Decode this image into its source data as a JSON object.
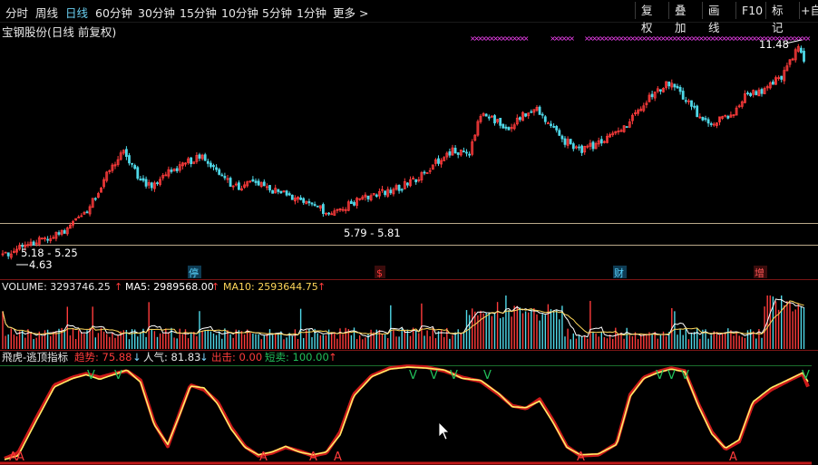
{
  "toolbar": {
    "periods": [
      "分时",
      "周线",
      "日线",
      "60分钟",
      "30分钟",
      "15分钟",
      "10分钟",
      "5分钟",
      "1分钟",
      "更多 >"
    ],
    "active_period": "日线",
    "right_buttons": [
      "复权",
      "叠加",
      "画线",
      "F10",
      "标记",
      "+自"
    ]
  },
  "stock_title": "宝钢股份(日线 前复权)",
  "colors": {
    "up": "#ff3b3b",
    "down": "#4fd8e8",
    "bg": "#000000",
    "ma5": "#ffffff",
    "ma10": "#ffd75a",
    "indicator_red": "#cc1a1a",
    "indicator_yellow": "#ffee66",
    "signal_green": "#22c05a",
    "marker_magenta": "#ff44ff"
  },
  "main_panel": {
    "annotations": {
      "high": "11.48",
      "low": "4.63",
      "zone1": "5.18 - 5.25",
      "zone2": "5.79 - 5.81"
    },
    "event_markers": [
      "停",
      "$",
      "财",
      "增"
    ]
  },
  "volume_panel": {
    "label_volume": "VOLUME: 3293746.25",
    "label_ma5": "MA5: 2989568.00",
    "label_ma10": "MA10: 2593644.75",
    "arrow": "↑"
  },
  "indicator_panel": {
    "name": "飛虎-逃顶指标",
    "trend_label": "趋势: 75.88",
    "trend_arrow": "↓",
    "popularity_label": "人气: 81.83",
    "popularity_arrow": "↓",
    "exit_label": "出击: 0.00",
    "short_label": "短卖: 100.00",
    "short_arrow": "↑",
    "signal_top": "V",
    "signal_bottom": "A"
  },
  "chart_data": [
    {
      "type": "candlestick",
      "title": "宝钢股份(日线 前复权)",
      "ylim": [
        4.3,
        12.1
      ],
      "price_path": [
        [
          0,
          4.9
        ],
        [
          10,
          4.75
        ],
        [
          25,
          5.2
        ],
        [
          45,
          5.3
        ],
        [
          70,
          5.6
        ],
        [
          95,
          6.2
        ],
        [
          115,
          7.3
        ],
        [
          135,
          8.2
        ],
        [
          150,
          7.4
        ],
        [
          165,
          7.0
        ],
        [
          185,
          7.5
        ],
        [
          200,
          7.7
        ],
        [
          220,
          8.0
        ],
        [
          240,
          7.4
        ],
        [
          260,
          7.0
        ],
        [
          280,
          7.2
        ],
        [
          300,
          6.9
        ],
        [
          320,
          6.7
        ],
        [
          340,
          6.5
        ],
        [
          360,
          6.2
        ],
        [
          375,
          6.3
        ],
        [
          395,
          6.6
        ],
        [
          415,
          6.8
        ],
        [
          440,
          7.0
        ],
        [
          460,
          7.3
        ],
        [
          480,
          7.8
        ],
        [
          500,
          8.2
        ],
        [
          515,
          8.0
        ],
        [
          530,
          9.4
        ],
        [
          545,
          9.1
        ],
        [
          560,
          8.9
        ],
        [
          575,
          9.3
        ],
        [
          590,
          9.5
        ],
        [
          605,
          9.0
        ],
        [
          620,
          8.5
        ],
        [
          640,
          8.2
        ],
        [
          660,
          8.4
        ],
        [
          680,
          8.7
        ],
        [
          700,
          9.3
        ],
        [
          720,
          10.0
        ],
        [
          740,
          10.4
        ],
        [
          750,
          10.0
        ],
        [
          760,
          9.6
        ],
        [
          775,
          9.1
        ],
        [
          790,
          9.1
        ],
        [
          805,
          9.3
        ],
        [
          820,
          9.9
        ],
        [
          840,
          10.1
        ],
        [
          860,
          10.5
        ],
        [
          870,
          11.0
        ],
        [
          880,
          11.48
        ],
        [
          888,
          10.7
        ]
      ]
    },
    {
      "type": "bar",
      "title": "VOLUME",
      "series": [
        {
          "name": "VOLUME",
          "last": 3293746.25
        },
        {
          "name": "MA5",
          "last": 2989568.0
        },
        {
          "name": "MA10",
          "last": 2593644.75
        }
      ]
    },
    {
      "type": "line",
      "title": "飛虎-逃顶指标",
      "ylim": [
        0,
        100
      ],
      "series": [
        {
          "name": "趋势",
          "last": 75.88,
          "values": [
            [
              5,
              2
            ],
            [
              20,
              8
            ],
            [
              40,
              45
            ],
            [
              60,
              80
            ],
            [
              80,
              88
            ],
            [
              95,
              92
            ],
            [
              110,
              88
            ],
            [
              125,
              92
            ],
            [
              140,
              95
            ],
            [
              155,
              85
            ],
            [
              170,
              40
            ],
            [
              185,
              15
            ],
            [
              200,
              55
            ],
            [
              210,
              80
            ],
            [
              225,
              75
            ],
            [
              240,
              62
            ],
            [
              255,
              35
            ],
            [
              270,
              15
            ],
            [
              285,
              5
            ],
            [
              300,
              8
            ],
            [
              315,
              14
            ],
            [
              330,
              10
            ],
            [
              345,
              5
            ],
            [
              360,
              8
            ],
            [
              375,
              30
            ],
            [
              390,
              70
            ],
            [
              410,
              90
            ],
            [
              430,
              98
            ],
            [
              450,
              100
            ],
            [
              470,
              99
            ],
            [
              490,
              95
            ],
            [
              510,
              88
            ],
            [
              530,
              84
            ],
            [
              550,
              70
            ],
            [
              565,
              58
            ],
            [
              580,
              55
            ],
            [
              595,
              65
            ],
            [
              610,
              42
            ],
            [
              625,
              15
            ],
            [
              640,
              5
            ],
            [
              660,
              6
            ],
            [
              680,
              18
            ],
            [
              695,
              70
            ],
            [
              710,
              88
            ],
            [
              725,
              94
            ],
            [
              740,
              98
            ],
            [
              755,
              95
            ],
            [
              770,
              60
            ],
            [
              785,
              30
            ],
            [
              800,
              12
            ],
            [
              815,
              20
            ],
            [
              830,
              60
            ],
            [
              850,
              75
            ],
            [
              870,
              85
            ],
            [
              885,
              92
            ],
            [
              892,
              76
            ]
          ]
        },
        {
          "name": "人气",
          "last": 81.83,
          "values": [
            [
              5,
              1
            ],
            [
              20,
              5
            ],
            [
              40,
              42
            ],
            [
              60,
              78
            ],
            [
              80,
              87
            ],
            [
              95,
              91
            ],
            [
              110,
              86
            ],
            [
              125,
              91
            ],
            [
              140,
              96
            ],
            [
              155,
              83
            ],
            [
              170,
              38
            ],
            [
              185,
              17
            ],
            [
              200,
              53
            ],
            [
              210,
              79
            ],
            [
              225,
              77
            ],
            [
              240,
              60
            ],
            [
              255,
              33
            ],
            [
              270,
              14
            ],
            [
              285,
              6
            ],
            [
              300,
              9
            ],
            [
              315,
              15
            ],
            [
              330,
              9
            ],
            [
              345,
              6
            ],
            [
              360,
              9
            ],
            [
              375,
              27
            ],
            [
              390,
              68
            ],
            [
              410,
              89
            ],
            [
              430,
              97
            ],
            [
              450,
              99
            ],
            [
              470,
              98
            ],
            [
              490,
              96
            ],
            [
              510,
              87
            ],
            [
              530,
              85
            ],
            [
              550,
              71
            ],
            [
              565,
              57
            ],
            [
              580,
              56
            ],
            [
              595,
              63
            ],
            [
              610,
              40
            ],
            [
              625,
              14
            ],
            [
              640,
              6
            ],
            [
              660,
              7
            ],
            [
              680,
              17
            ],
            [
              695,
              68
            ],
            [
              710,
              87
            ],
            [
              725,
              93
            ],
            [
              740,
              97
            ],
            [
              755,
              94
            ],
            [
              770,
              58
            ],
            [
              785,
              28
            ],
            [
              800,
              13
            ],
            [
              815,
              22
            ],
            [
              830,
              62
            ],
            [
              850,
              77
            ],
            [
              870,
              86
            ],
            [
              885,
              93
            ],
            [
              892,
              82
            ]
          ]
        },
        {
          "name": "出击",
          "last": 0.0
        },
        {
          "name": "短卖",
          "last": 100.0
        }
      ]
    }
  ]
}
